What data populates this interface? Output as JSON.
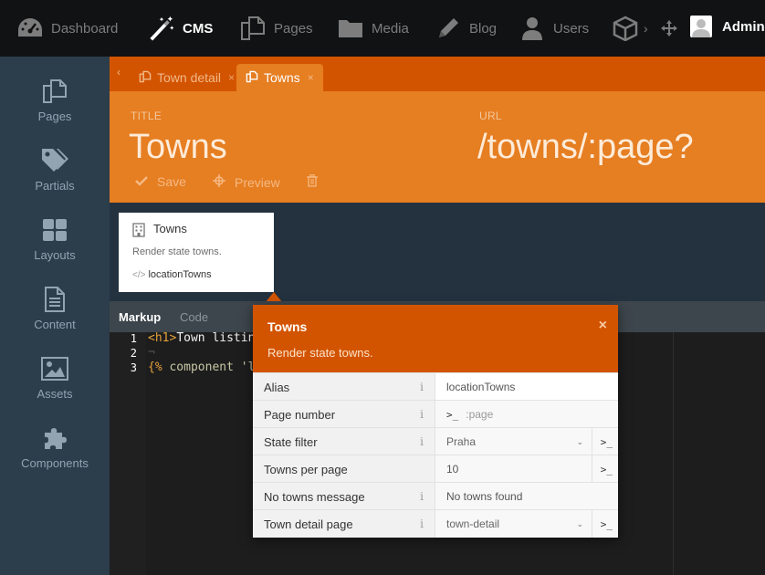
{
  "topnav": {
    "items": [
      {
        "label": "Dashboard",
        "icon": "dashboard-icon"
      },
      {
        "label": "CMS",
        "icon": "magic-wand-icon"
      },
      {
        "label": "Pages",
        "icon": "pages-icon"
      },
      {
        "label": "Media",
        "icon": "folder-icon"
      },
      {
        "label": "Blog",
        "icon": "pencil-icon"
      },
      {
        "label": "Users",
        "icon": "user-icon"
      }
    ],
    "more_arrow": "›",
    "admin_label": "Admin"
  },
  "sidebar": {
    "items": [
      {
        "label": "Pages",
        "icon": "pages-icon"
      },
      {
        "label": "Partials",
        "icon": "tags-icon"
      },
      {
        "label": "Layouts",
        "icon": "layout-icon"
      },
      {
        "label": "Content",
        "icon": "file-icon"
      },
      {
        "label": "Assets",
        "icon": "image-icon"
      },
      {
        "label": "Components",
        "icon": "puzzle-icon"
      }
    ]
  },
  "tabs": [
    {
      "label": "Town detail",
      "close": "×"
    },
    {
      "label": "Towns",
      "close": "×"
    }
  ],
  "form": {
    "title_label": "TITLE",
    "title_value": "Towns",
    "url_label": "URL",
    "url_value": "/towns/:page?",
    "save_label": "Save",
    "preview_label": "Preview"
  },
  "component": {
    "title": "Towns",
    "description": "Render state towns.",
    "alias": "locationTowns"
  },
  "editor": {
    "tabs": [
      "Markup",
      "Code"
    ],
    "line_numbers": [
      "1",
      "2",
      "3"
    ],
    "line1_tag": "<h1>",
    "line1_text": "Town listing",
    "line3_open": "{%",
    "line3_text": " component 'lo"
  },
  "inspector": {
    "title": "Towns",
    "description": "Render state towns.",
    "close": "×",
    "info_glyph": "i",
    "prompt_glyph": ">_",
    "chevron_glyph": "⌄",
    "rows": [
      {
        "label": "Alias",
        "value": "locationTowns"
      },
      {
        "label": "Page number",
        "value": ":page"
      },
      {
        "label": "State filter",
        "value": "Praha"
      },
      {
        "label": "Towns per page",
        "value": "10"
      },
      {
        "label": "No towns message",
        "value": "No towns found"
      },
      {
        "label": "Town detail page",
        "value": "town-detail"
      }
    ]
  },
  "colors": {
    "accent_orange": "#e67e22",
    "dark_orange": "#d35400",
    "sidebar_bg": "#2c3d4c",
    "topbar_bg": "#111213"
  }
}
